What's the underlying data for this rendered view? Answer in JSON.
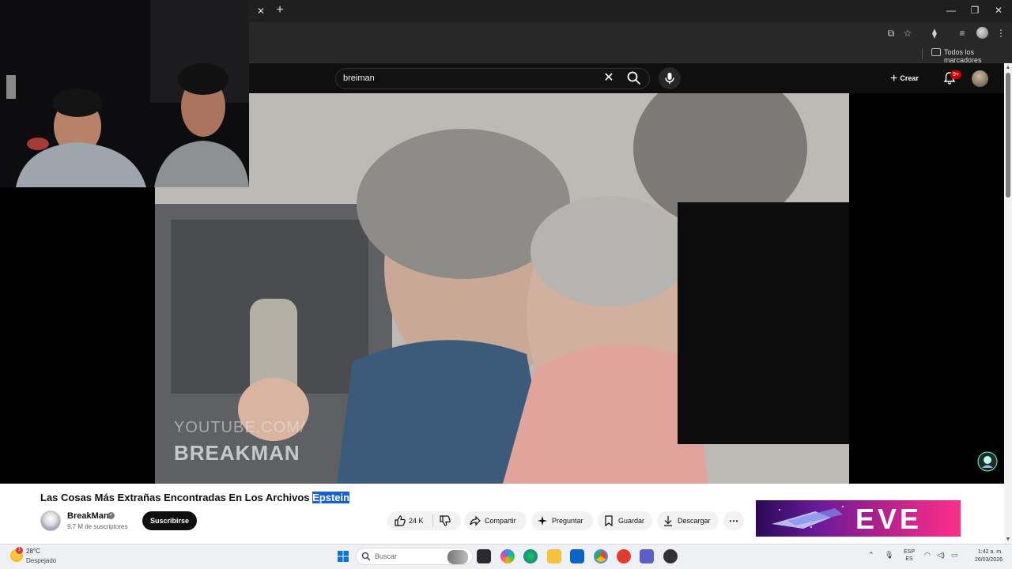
{
  "browser": {
    "bookmarks_label": "Todos los marcadores"
  },
  "header": {
    "search_value": "breiman",
    "create_label": "Crear",
    "notifications_badge": "9+"
  },
  "video": {
    "watermark_line1": "YOUTUBE.COM/",
    "watermark_line2": "BREAKMAN"
  },
  "info": {
    "title_main": "Las Cosas Más Extrañas Encontradas En Los Archivos ",
    "title_highlight": "Epstein",
    "channel_name": "BreakMan",
    "subscribers": "9,7 M de suscriptores",
    "subscribe_label": "Suscribirse",
    "likes": "24 K",
    "share_label": "Compartir",
    "ask_label": "Preguntar",
    "save_label": "Guardar",
    "download_label": "Descargar"
  },
  "ad": {
    "text": "EVE"
  },
  "taskbar": {
    "weather_temp": "28°C",
    "weather_condition": "Despejado",
    "weather_badge": "1",
    "search_placeholder": "Buscar",
    "lang_line1": "ESP",
    "lang_line2": "ES",
    "time": "1:42 a. m.",
    "date": "26/03/2026"
  },
  "colors": {
    "accent_red": "#cc0000",
    "highlight_blue": "#1a5fd2"
  }
}
